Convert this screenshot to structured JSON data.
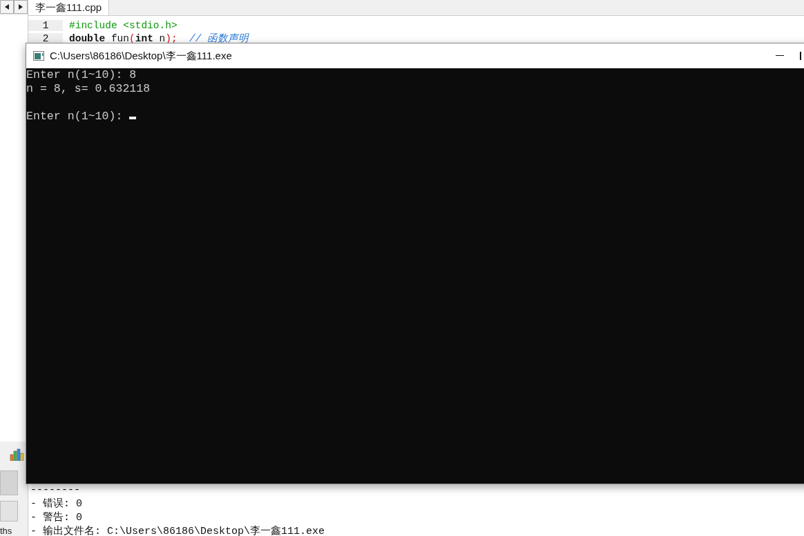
{
  "ide": {
    "tabs": [
      {
        "label": "李一鑫111.cpp",
        "selected": true
      }
    ],
    "editor": {
      "lines": [
        {
          "number": "1",
          "tokens": [
            {
              "kind": "preprocessor",
              "text": "#include <stdio.h>"
            }
          ]
        },
        {
          "number": "2",
          "tokens": [
            {
              "kind": "keyword",
              "text": "double"
            },
            {
              "kind": "plain",
              "text": " fun"
            },
            {
              "kind": "symbol",
              "text": "("
            },
            {
              "kind": "keyword",
              "text": "int"
            },
            {
              "kind": "plain",
              "text": " n"
            },
            {
              "kind": "symbol",
              "text": ");"
            },
            {
              "kind": "comment",
              "text": "  // 函数声明"
            }
          ]
        }
      ]
    },
    "side_label": "ths",
    "log_lines": [
      "--------",
      "- 错误: 0",
      "- 警告: 0",
      "- 输出文件名: C:\\Users\\86186\\Desktop\\李一鑫111.exe"
    ]
  },
  "console": {
    "title": "C:\\Users\\86186\\Desktop\\李一鑫111.exe",
    "output": "Enter n(1~10): 8\nn = 8, s= 0.632118\n\nEnter n(1~10): ",
    "cursor_visible": true
  }
}
